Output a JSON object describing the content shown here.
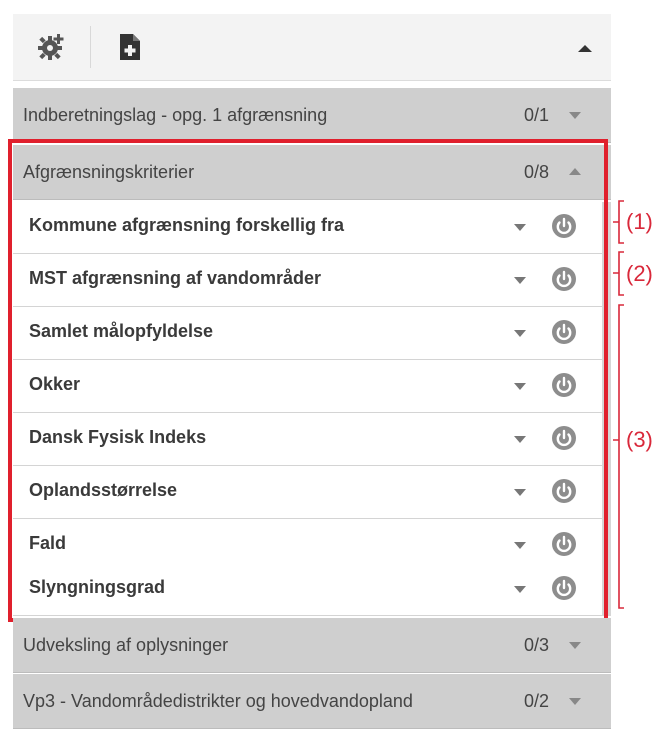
{
  "toolbar": {
    "settings_icon": "gear-plus-icon",
    "new_icon": "new-document-icon",
    "collapse_icon": "caret-up-icon"
  },
  "groups": {
    "indberetning": {
      "label": "Indberetningslag - opg. 1 afgrænsning",
      "count": "0/1"
    },
    "afgraensning": {
      "label": "Afgrænsningskriterier",
      "count": "0/8"
    },
    "udveksling": {
      "label": "Udveksling af oplysninger",
      "count": "0/3"
    },
    "vp3": {
      "label": "Vp3 - Vandområdedistrikter og hovedvandopland",
      "count": "0/2"
    }
  },
  "items": [
    {
      "label": "Kommune afgrænsning forskellig fra"
    },
    {
      "label": "MST afgrænsning af vandområder"
    },
    {
      "label": "Samlet målopfyldelse"
    },
    {
      "label": "Okker"
    },
    {
      "label": "Dansk Fysisk Indeks"
    },
    {
      "label": "Oplandsstørrelse"
    },
    {
      "label": "Fald"
    },
    {
      "label": "Slyngningsgrad"
    }
  ],
  "annotations": {
    "a1": "(1)",
    "a2": "(2)",
    "a3": "(3)"
  },
  "colors": {
    "highlight": "#e0202d",
    "annotation": "#d9283a",
    "group_bg": "#cfcfcf"
  }
}
